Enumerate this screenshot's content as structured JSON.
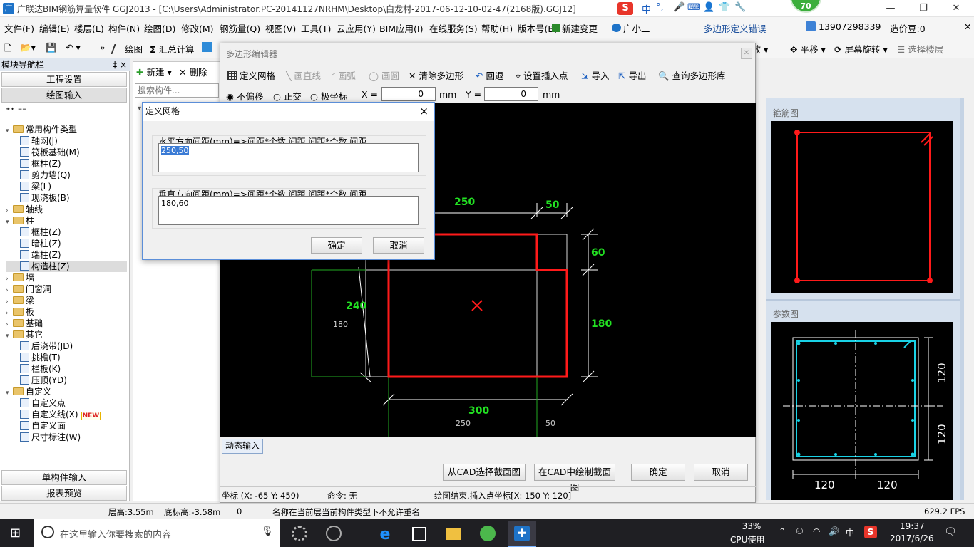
{
  "window": {
    "title": "广联达BIM钢筋算量软件 GGJ2013 - [C:\\Users\\Administrator.PC-20141127NRHM\\Desktop\\白龙村-2017-06-12-10-02-47(2168版).GGJ12]",
    "badge": "70",
    "ime": "中"
  },
  "menu": {
    "items": [
      "文件(F)",
      "编辑(E)",
      "楼层(L)",
      "构件(N)",
      "绘图(D)",
      "修改(M)",
      "钢筋量(Q)",
      "视图(V)",
      "工具(T)",
      "云应用(Y)",
      "BIM应用(I)",
      "在线服务(S)",
      "帮助(H)",
      "版本号(B)",
      "新建变更",
      "广小二"
    ],
    "right_notice": "多边形定义错误",
    "phone": "13907298339",
    "price_bean": "造价豆:0"
  },
  "toolbar": {
    "draw": "绘图",
    "sum": "汇总计算",
    "zoom": "缩放",
    "pan": "平移",
    "rotate": "屏幕旋转",
    "select_floor": "选择楼层"
  },
  "leftnav": {
    "header": "模块导航栏",
    "pin": "‡ ×",
    "btn_project": "工程设置",
    "btn_draw_input": "绘图输入",
    "btn_single": "单构件输入",
    "btn_report": "报表预览",
    "tree": [
      {
        "label": "常用构件类型",
        "level": 0,
        "kind": "folder",
        "exp": "▾"
      },
      {
        "label": "轴网(J)",
        "level": 1,
        "kind": "comp"
      },
      {
        "label": "筏板基础(M)",
        "level": 1,
        "kind": "comp"
      },
      {
        "label": "框柱(Z)",
        "level": 1,
        "kind": "comp"
      },
      {
        "label": "剪力墙(Q)",
        "level": 1,
        "kind": "comp"
      },
      {
        "label": "梁(L)",
        "level": 1,
        "kind": "comp"
      },
      {
        "label": "现浇板(B)",
        "level": 1,
        "kind": "comp"
      },
      {
        "label": "轴线",
        "level": 0,
        "kind": "folder",
        "exp": "›"
      },
      {
        "label": "柱",
        "level": 0,
        "kind": "folder",
        "exp": "▾"
      },
      {
        "label": "框柱(Z)",
        "level": 1,
        "kind": "comp"
      },
      {
        "label": "暗柱(Z)",
        "level": 1,
        "kind": "comp"
      },
      {
        "label": "端柱(Z)",
        "level": 1,
        "kind": "comp"
      },
      {
        "label": "构造柱(Z)",
        "level": 1,
        "kind": "comp",
        "selected": true
      },
      {
        "label": "墙",
        "level": 0,
        "kind": "folder",
        "exp": "›"
      },
      {
        "label": "门窗洞",
        "level": 0,
        "kind": "folder",
        "exp": "›"
      },
      {
        "label": "梁",
        "level": 0,
        "kind": "folder",
        "exp": "›"
      },
      {
        "label": "板",
        "level": 0,
        "kind": "folder",
        "exp": "›"
      },
      {
        "label": "基础",
        "level": 0,
        "kind": "folder",
        "exp": "›"
      },
      {
        "label": "其它",
        "level": 0,
        "kind": "folder",
        "exp": "▾"
      },
      {
        "label": "后浇带(JD)",
        "level": 1,
        "kind": "comp"
      },
      {
        "label": "挑檐(T)",
        "level": 1,
        "kind": "comp"
      },
      {
        "label": "栏板(K)",
        "level": 1,
        "kind": "comp"
      },
      {
        "label": "压顶(YD)",
        "level": 1,
        "kind": "comp"
      },
      {
        "label": "自定义",
        "level": 0,
        "kind": "folder",
        "exp": "▾"
      },
      {
        "label": "自定义点",
        "level": 1,
        "kind": "comp"
      },
      {
        "label": "自定义线(X)",
        "level": 1,
        "kind": "comp",
        "new": "NEW"
      },
      {
        "label": "自定义面",
        "level": 1,
        "kind": "comp"
      },
      {
        "label": "尺寸标注(W)",
        "level": 1,
        "kind": "comp"
      }
    ]
  },
  "midpanel": {
    "new": "新建",
    "delete": "删除",
    "search_placeholder": "搜索构件..."
  },
  "poly_editor": {
    "title": "多边形编辑器",
    "tools": {
      "define_grid": "定义网格",
      "line": "画直线",
      "arc": "画弧",
      "circle": "画圆",
      "clear": "清除多边形",
      "undo": "回退",
      "set_insert": "设置插入点",
      "import": "导入",
      "export": "导出",
      "query": "查询多边形库"
    },
    "offset": {
      "none": "不偏移",
      "ortho": "正交",
      "polar": "极坐标",
      "x_label": "X =",
      "x_value": "0",
      "y_label": "Y =",
      "y_value": "0",
      "unit": "mm"
    },
    "dynamic_input": "动态输入",
    "btn_from_cad": "从CAD选择截面图",
    "btn_draw_cad": "在CAD中绘制截面图",
    "btn_ok": "确定",
    "btn_cancel": "取消",
    "status_coord": "坐标 (X: -65 Y: 459)",
    "status_cmd": "命令: 无",
    "status_msg": "绘图结束,插入点坐标[X: 150 Y: 120]",
    "dims": {
      "top_left": "250",
      "top_right": "50",
      "right_top": "60",
      "right_bottom": "180",
      "left_main": "240",
      "left_sub": "180",
      "bottom_main": "300",
      "bottom_left": "250",
      "bottom_right": "50"
    }
  },
  "grid_dialog": {
    "title": "定义网格",
    "close": "×",
    "h_label": "水平方向间距(mm)=>间距*个数,间距,间距*个数,间距,...",
    "h_value": "250,50",
    "v_label": "垂直方向间距(mm)=>间距*个数,间距,间距*个数,间距,...",
    "v_value": "180,60",
    "ok": "确定",
    "cancel": "取消"
  },
  "right": {
    "stirrup_title": "箍筋图",
    "param_title": "参数图",
    "dim_120_a": "120",
    "dim_120_b": "120",
    "dim_120_c": "120",
    "dim_120_d": "120"
  },
  "statusbar": {
    "floor_h": "层高:3.55m",
    "floor_base": "底标高:-3.58m",
    "zero": "0",
    "message": "名称在当前层当前构件类型下不允许重名",
    "fps": "629.2 FPS"
  },
  "taskbar": {
    "search": "在这里输入你要搜索的内容",
    "cpu_pct": "33%",
    "cpu_label": "CPU使用",
    "ime": "中",
    "time": "19:37",
    "date": "2017/6/26"
  },
  "colors": {
    "red_outline": "#ff1a1a",
    "green_dim": "#22e022",
    "cyan_rebar": "#19d2e6",
    "canvas_bg": "#000000"
  }
}
